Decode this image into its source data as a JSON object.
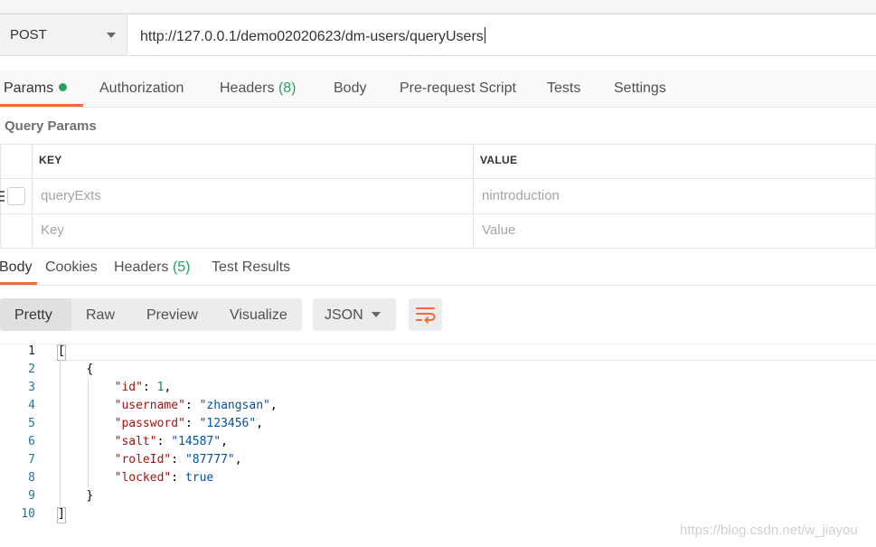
{
  "request": {
    "method": "POST",
    "url": "http://127.0.0.1/demo02020623/dm-users/queryUsers"
  },
  "request_tabs": [
    {
      "label": "Params",
      "active": true,
      "dot": true
    },
    {
      "label": "Authorization"
    },
    {
      "label": "Headers",
      "count": "(8)"
    },
    {
      "label": "Body"
    },
    {
      "label": "Pre-request Script"
    },
    {
      "label": "Tests"
    },
    {
      "label": "Settings"
    }
  ],
  "query_params": {
    "title": "Query Params",
    "headers": {
      "key": "KEY",
      "value": "VALUE"
    },
    "rows": [
      {
        "key": "queryExts",
        "value": "nintroduction"
      }
    ],
    "placeholders": {
      "key": "Key",
      "value": "Value"
    }
  },
  "response_tabs": [
    {
      "label": "Body",
      "active": true
    },
    {
      "label": "Cookies"
    },
    {
      "label": "Headers",
      "count": "(5)"
    },
    {
      "label": "Test Results"
    }
  ],
  "view_modes": [
    "Pretty",
    "Raw",
    "Preview",
    "Visualize"
  ],
  "format": "JSON",
  "code": {
    "line_numbers": [
      "1",
      "2",
      "3",
      "4",
      "5",
      "6",
      "7",
      "8",
      "9",
      "10"
    ],
    "fields": [
      {
        "key": "\"id\"",
        "value": "1",
        "kind": "num",
        "comma": ","
      },
      {
        "key": "\"username\"",
        "value": "\"zhangsan\"",
        "kind": "str",
        "comma": ","
      },
      {
        "key": "\"password\"",
        "value": "\"123456\"",
        "kind": "str",
        "comma": ","
      },
      {
        "key": "\"salt\"",
        "value": "\"14587\"",
        "kind": "str",
        "comma": ","
      },
      {
        "key": "\"roleId\"",
        "value": "\"87777\"",
        "kind": "str",
        "comma": ","
      },
      {
        "key": "\"locked\"",
        "value": "true",
        "kind": "kw",
        "comma": ""
      }
    ],
    "open_array": "[",
    "close_array": "]",
    "open_obj": "{",
    "close_obj": "}"
  },
  "watermark": "https://blog.csdn.net/w_jiayou",
  "colors": {
    "accent": "#f26b3a",
    "green": "#26a05e"
  }
}
